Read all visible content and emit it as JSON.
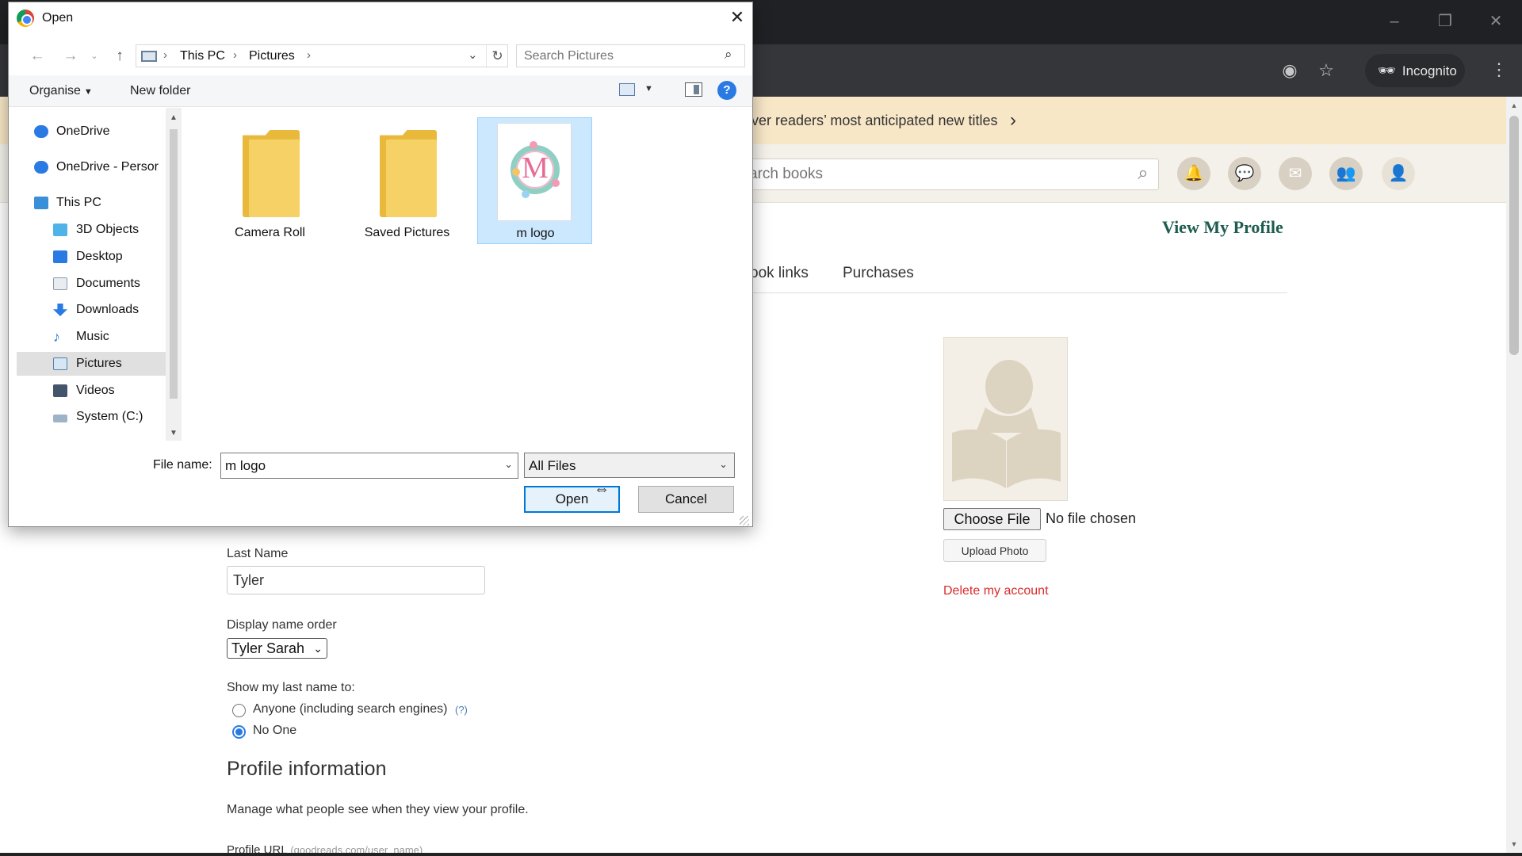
{
  "browser": {
    "incognito_label": "Incognito",
    "icons": [
      "eye-off-icon",
      "star-icon",
      "incognito-icon",
      "kebab-menu-icon",
      "minimize-icon",
      "restore-icon",
      "window-close-icon"
    ]
  },
  "page": {
    "banner_text": "ver readers’ most anticipated new titles",
    "search_placeholder": "arch books",
    "view_profile": "View My Profile",
    "tabs": [
      "ook links",
      "Purchases"
    ],
    "choose_file": "Choose File",
    "no_file": "No file chosen",
    "upload_photo": "Upload Photo",
    "delete_account": "Delete my account",
    "last_name_label": "Last Name",
    "last_name_value": "Tyler",
    "display_order_label": "Display name order",
    "display_order_value": "Tyler Sarah",
    "show_last_name_label": "Show my last name to:",
    "radio_anyone": "Anyone (including search engines)",
    "radio_help": "(?)",
    "radio_noone": "No One",
    "radio_selected": "No One",
    "profile_info_heading": "Profile information",
    "profile_info_desc": "Manage what people see when they view your profile.",
    "profile_url_label": "Profile URL",
    "profile_url_hint": "(goodreads.com/user_name)"
  },
  "dialog": {
    "title": "Open",
    "address": [
      "This PC",
      "Pictures"
    ],
    "search_placeholder": "Search Pictures",
    "organise": "Organise",
    "new_folder": "New folder",
    "help": "?",
    "nav_items": [
      {
        "label": "OneDrive",
        "icon": "cloud-icon"
      },
      {
        "label": "OneDrive - Persor",
        "icon": "cloud-icon"
      },
      {
        "label": "This PC",
        "icon": "computer-icon"
      },
      {
        "label": "3D Objects",
        "icon": "cube-icon"
      },
      {
        "label": "Desktop",
        "icon": "desktop-icon"
      },
      {
        "label": "Documents",
        "icon": "document-icon"
      },
      {
        "label": "Downloads",
        "icon": "download-icon"
      },
      {
        "label": "Music",
        "icon": "music-icon"
      },
      {
        "label": "Pictures",
        "icon": "pictures-icon"
      },
      {
        "label": "Videos",
        "icon": "video-icon"
      },
      {
        "label": "System (C:)",
        "icon": "drive-icon"
      }
    ],
    "selected_nav": "Pictures",
    "files": [
      {
        "label": "Camera Roll",
        "type": "folder"
      },
      {
        "label": "Saved Pictures",
        "type": "folder"
      },
      {
        "label": "m logo",
        "type": "image",
        "thumb_letter": "M"
      }
    ],
    "selected_file": "m logo",
    "file_name_label": "File name:",
    "file_name_value": "m logo",
    "file_type_value": "All Files",
    "open_label": "Open",
    "cancel_label": "Cancel"
  }
}
